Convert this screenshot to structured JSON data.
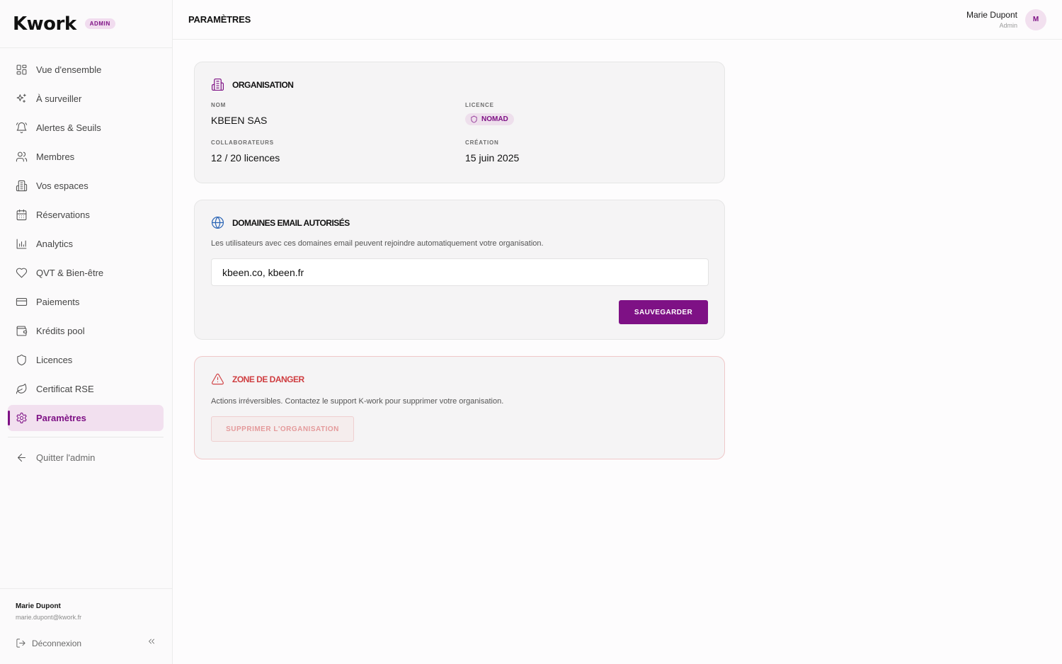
{
  "brand": {
    "logo": "Kwork",
    "badge": "ADMIN"
  },
  "sidebar": {
    "items": [
      {
        "label": "Vue d'ensemble",
        "icon": "grid-icon"
      },
      {
        "label": "À surveiller",
        "icon": "sparkles-icon"
      },
      {
        "label": "Alertes & Seuils",
        "icon": "bell-icon"
      },
      {
        "label": "Membres",
        "icon": "users-icon"
      },
      {
        "label": "Vos espaces",
        "icon": "building-icon"
      },
      {
        "label": "Réservations",
        "icon": "calendar-icon"
      },
      {
        "label": "Analytics",
        "icon": "bar-chart-icon"
      },
      {
        "label": "QVT & Bien-être",
        "icon": "heart-icon"
      },
      {
        "label": "Paiements",
        "icon": "credit-card-icon"
      },
      {
        "label": "Krédits pool",
        "icon": "wallet-icon"
      },
      {
        "label": "Licences",
        "icon": "shield-icon"
      },
      {
        "label": "Certificat RSE",
        "icon": "leaf-icon"
      },
      {
        "label": "Paramètres",
        "icon": "gear-icon",
        "active": true
      }
    ],
    "quit_label": "Quitter l'admin",
    "footer": {
      "name": "Marie Dupont",
      "email": "marie.dupont@kwork.fr",
      "logout_label": "Déconnexion"
    }
  },
  "header": {
    "title": "PARAMÈTRES",
    "user_name": "Marie Dupont",
    "user_role": "Admin",
    "avatar_initial": "M"
  },
  "organisation": {
    "title": "ORGANISATION",
    "name_label": "NOM",
    "name_value": "KBEEN SAS",
    "licence_label": "LICENCE",
    "licence_value": "NOMAD",
    "collab_label": "COLLABORATEURS",
    "collab_value": "12 / 20 licences",
    "creation_label": "CRÉATION",
    "creation_value": "15 juin 2025"
  },
  "domains": {
    "title": "DOMAINES EMAIL AUTORISÉS",
    "description": "Les utilisateurs avec ces domaines email peuvent rejoindre automatiquement votre organisation.",
    "input_value": "kbeen.co, kbeen.fr",
    "save_label": "SAUVEGARDER"
  },
  "danger": {
    "title": "ZONE DE DANGER",
    "description": "Actions irréversibles. Contactez le support K-work pour supprimer votre organisation.",
    "delete_label": "SUPPRIMER L'ORGANISATION"
  },
  "colors": {
    "accent": "#7e1185",
    "accent_light": "#f2e0ef",
    "danger": "#cf3d40",
    "link_blue": "#2a64b5"
  }
}
